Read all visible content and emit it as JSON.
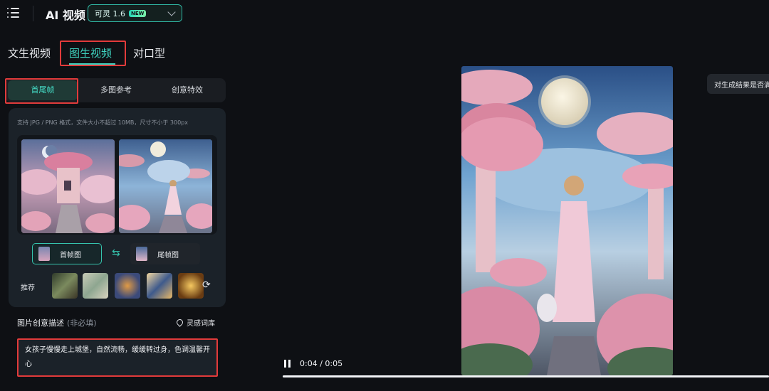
{
  "header": {
    "app_title": "AI 视频",
    "model_name": "可灵 1.6",
    "model_badge": "NEW"
  },
  "main_tabs": [
    "文生视频",
    "图生视频",
    "对口型"
  ],
  "active_main_tab": "图生视频",
  "sub_tabs": [
    "首尾帧",
    "多图参考",
    "创意特效"
  ],
  "active_sub_tab": "首尾帧",
  "upload": {
    "hint": "支持 JPG / PNG 格式，文件大小不超过 10MB，尺寸不小于 300px",
    "first_frame_label": "首帧图",
    "last_frame_label": "尾帧图"
  },
  "recommend": {
    "label": "推荐"
  },
  "description": {
    "label": "图片创意描述",
    "optional": "(非必填)",
    "library_link": "灵感词库",
    "prompt": "女孩子慢慢走上城堡，自然流畅，缓缓转过身，色调温馨开心"
  },
  "player": {
    "time": "0:04 / 0:05",
    "progress": 1.0
  },
  "tooltip": "对生成结果是否满意",
  "colors": {
    "accent": "#3fd3c0",
    "highlight_box": "#e23b3b"
  }
}
